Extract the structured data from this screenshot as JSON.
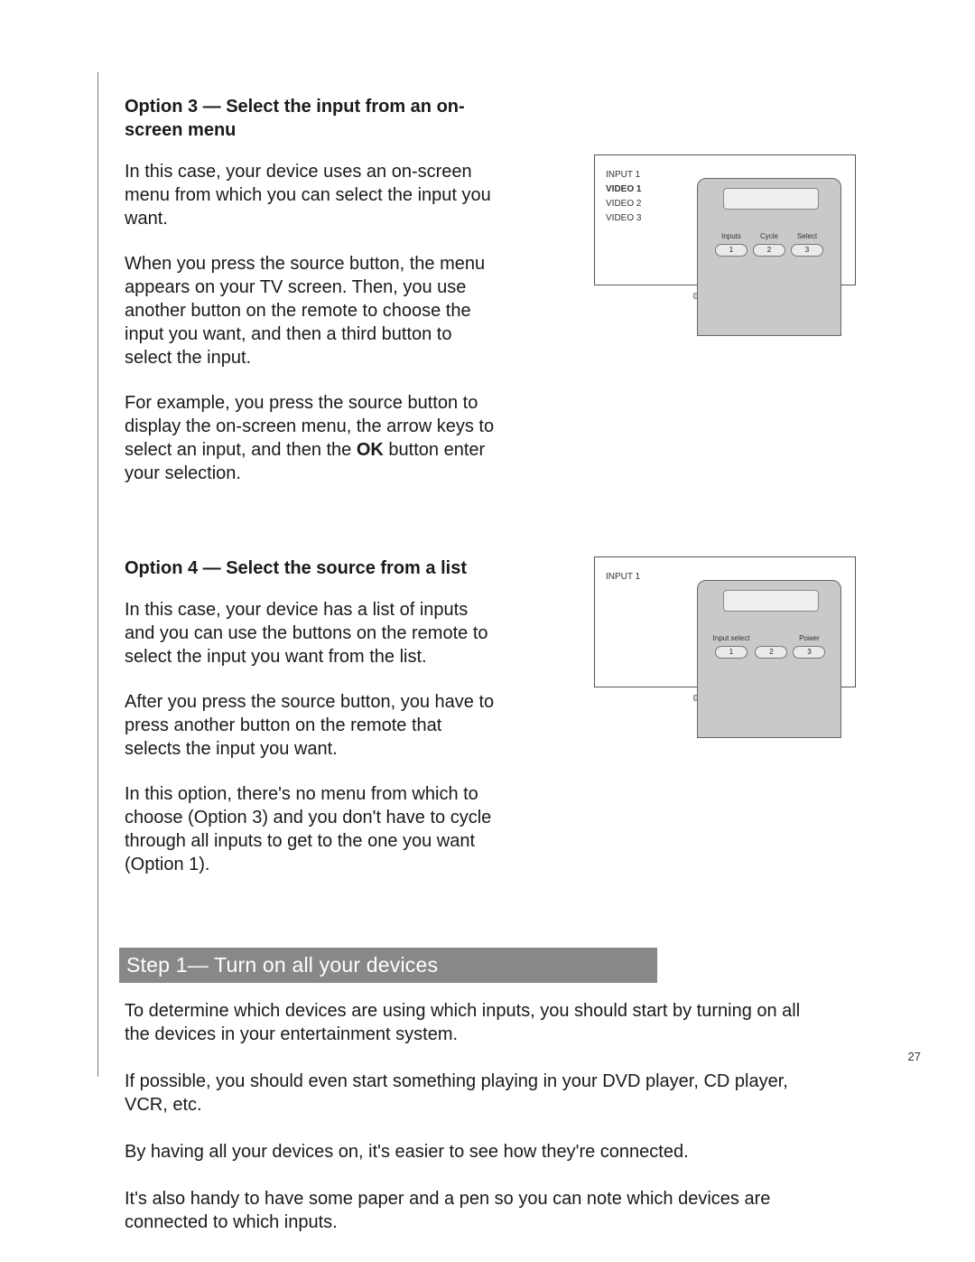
{
  "option3": {
    "heading": "Option 3 — Select the input from an on-screen menu",
    "p1": "In this case, your device uses an on-screen menu from which you can select the input you want.",
    "p2": "When you press the source button, the menu appears on your TV screen. Then, you use another button on the remote to choose the input you want, and then a third button to select the input.",
    "p3a": "For example, you press the source button to display the on-screen menu, the arrow keys to select an input, and then the ",
    "p3b": "OK",
    "p3c": " button enter your selection."
  },
  "option4": {
    "heading": "Option 4 — Select the source from a list",
    "p1": "In this case, your device has a list of inputs and you can use the buttons on the remote to select the input you want from the list.",
    "p2": "After you press the source button, you have to press another button on the remote that selects the input you want.",
    "p3": "In this option, there's no menu from which to choose (Option 3) and you don't have to cycle through all inputs to get to the one you want (Option 1)."
  },
  "step1": {
    "title": "Step 1— Turn on all your devices",
    "p1": "To determine which devices are using which inputs, you should start by turning on all the devices in your entertainment system.",
    "p2": "If possible, you should even start something playing in your DVD player, CD player, VCR, etc.",
    "p3": "By having all your devices on, it's easier to see how they're connected.",
    "p4": "It's also handy to have some paper and a pen so you can note which devices are connected to which inputs."
  },
  "fig1": {
    "osd": [
      "INPUT 1",
      "VIDEO 1",
      "VIDEO 2",
      "VIDEO 3"
    ],
    "selected_index": 1,
    "labels": [
      "Inputs",
      "Cycle",
      "Select"
    ],
    "btns": [
      "1",
      "2",
      "3"
    ]
  },
  "fig2": {
    "osd": [
      "INPUT 1"
    ],
    "selected_index": -1,
    "labels": [
      "Input select",
      "",
      "Power"
    ],
    "btns": [
      "1",
      "2",
      "3"
    ]
  },
  "page_number": "27"
}
